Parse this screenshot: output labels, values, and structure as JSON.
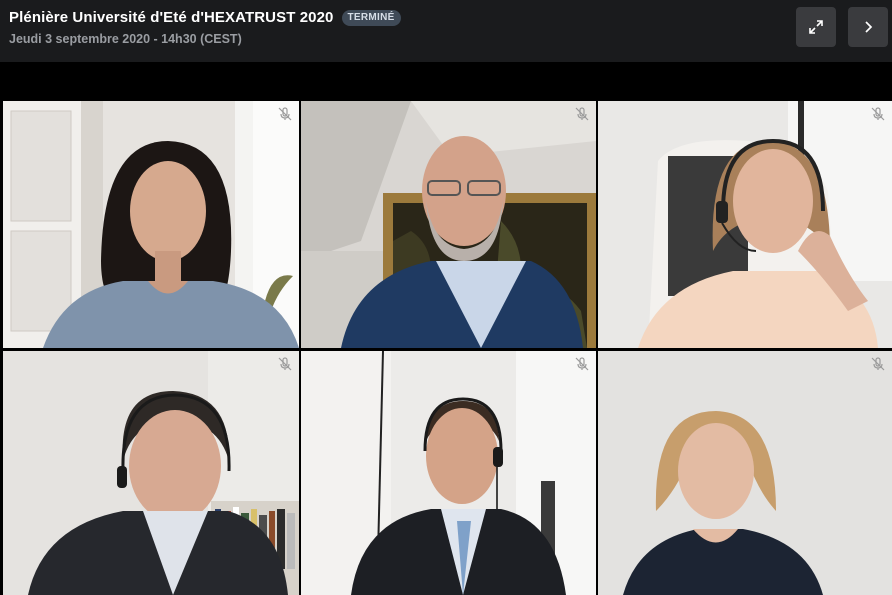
{
  "header": {
    "title": "Plénière Université d'Eté d'HEXATRUST 2020",
    "status_badge": "TERMINÉ",
    "subtitle": "Jeudi 3 septembre 2020 - 14h30 (CEST)",
    "buttons": {
      "expand_icon": "expand-arrows-icon",
      "next_icon": "chevron-right-icon"
    }
  },
  "participants": [
    {
      "id": "p1",
      "muted": true,
      "mic_icon": "mic-off-icon"
    },
    {
      "id": "p2",
      "muted": true,
      "mic_icon": "mic-off-icon"
    },
    {
      "id": "p3",
      "muted": true,
      "mic_icon": "mic-off-icon"
    },
    {
      "id": "p4",
      "muted": true,
      "mic_icon": "mic-off-icon"
    },
    {
      "id": "p5",
      "muted": true,
      "mic_icon": "mic-off-icon"
    },
    {
      "id": "p6",
      "muted": true,
      "mic_icon": "mic-off-icon"
    }
  ],
  "colors": {
    "header_bg": "#1a1b1d",
    "badge_bg": "#3f4a57",
    "button_bg": "#3a3b3e"
  }
}
